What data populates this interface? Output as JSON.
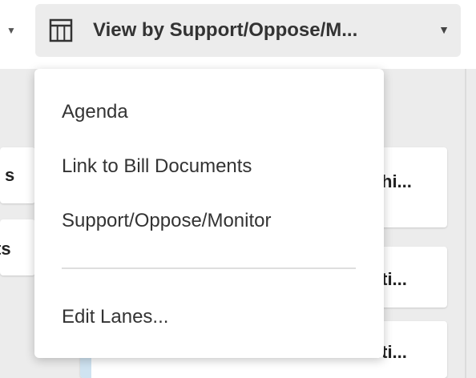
{
  "toolbar": {
    "view_button_label": "View by Support/Oppose/M..."
  },
  "cards": {
    "left_1": "s",
    "left_2": "ts",
    "right_1": "hi...",
    "right_2": "iti...",
    "right_3": "iti..."
  },
  "menu": {
    "items": [
      {
        "label": "Agenda"
      },
      {
        "label": "Link to Bill Documents"
      },
      {
        "label": "Support/Oppose/Monitor"
      }
    ],
    "edit_lanes": "Edit Lanes..."
  },
  "icons": {
    "view": "table-columns-icon",
    "caret": "caret-down-icon"
  },
  "colors": {
    "board_bg": "#ececec",
    "card_accent": "#cfe3f1"
  }
}
